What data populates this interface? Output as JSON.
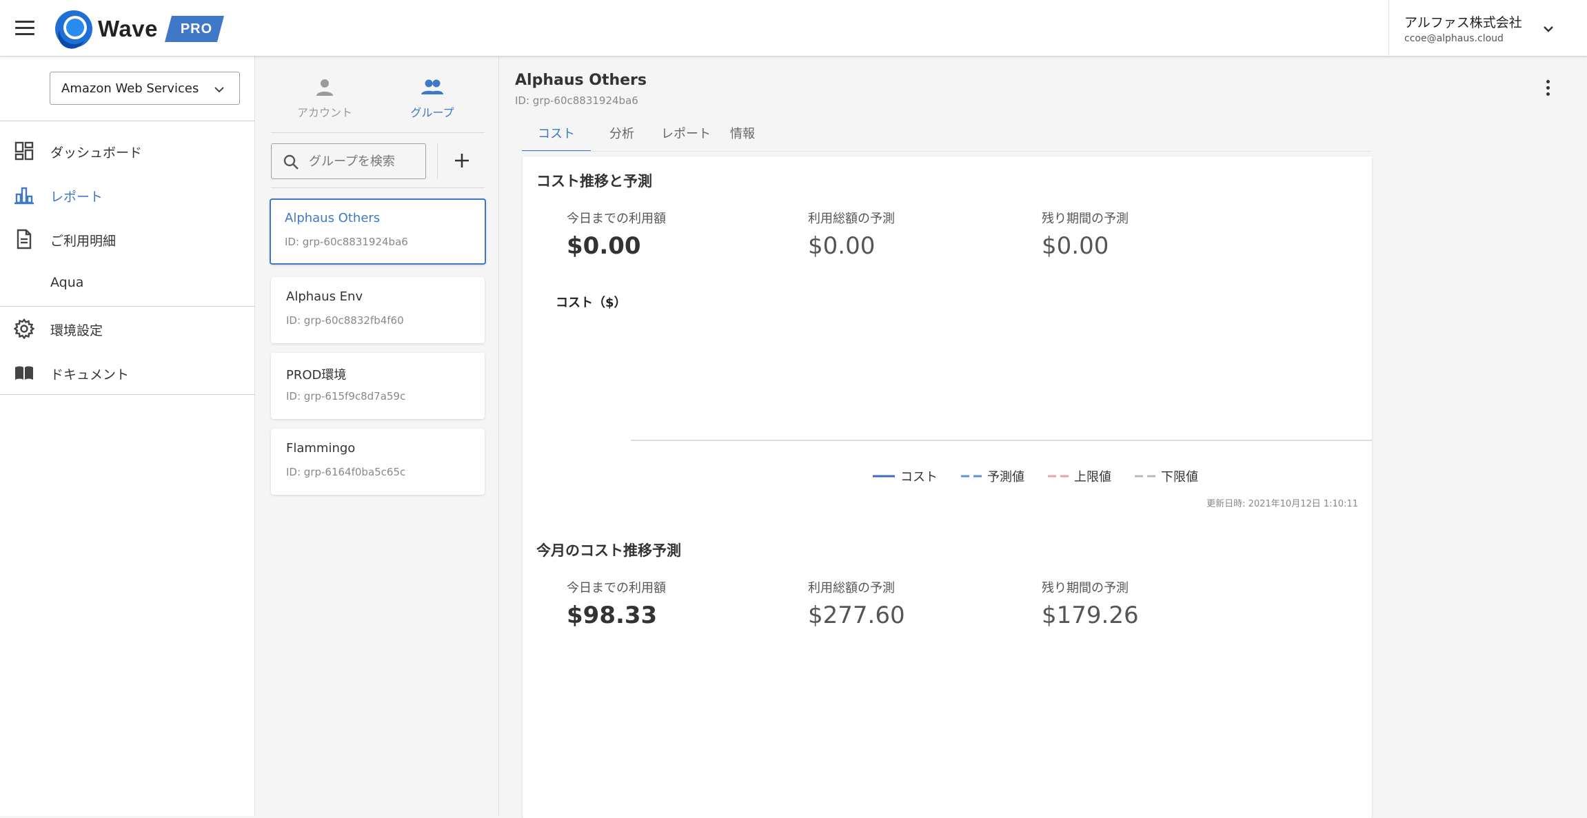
{
  "header": {
    "logo_text": "Wave",
    "logo_badge": "PRO",
    "account_name": "アルファス株式会社",
    "account_email": "ccoe@alphaus.cloud"
  },
  "sidebar": {
    "provider": "Amazon Web Services",
    "items": [
      {
        "label": "ダッシュボード",
        "icon": "dashboard-icon"
      },
      {
        "label": "レポート",
        "icon": "bar-chart-icon",
        "active": true
      },
      {
        "label": "ご利用明細",
        "icon": "document-icon"
      },
      {
        "label": "Aqua",
        "icon": ""
      },
      {
        "label": "環境設定",
        "icon": "gear-icon"
      },
      {
        "label": "ドキュメント",
        "icon": "book-icon"
      }
    ]
  },
  "groups_panel": {
    "tab_account": "アカウント",
    "tab_group": "グループ",
    "search_placeholder": "グループを検索",
    "groups": [
      {
        "name": "Alphaus Others",
        "id": "ID: grp-60c8831924ba6"
      },
      {
        "name": "Alphaus Env",
        "id": "ID: grp-60c8832fb4f60"
      },
      {
        "name": "PROD環境",
        "id": "ID: grp-615f9c8d7a59c"
      },
      {
        "name": "Flammingo",
        "id": "ID: grp-6164f0ba5c65c"
      }
    ]
  },
  "main": {
    "title": "Alphaus Others",
    "id": "ID: grp-60c8831924ba6",
    "tabs": [
      "コスト",
      "分析",
      "レポート",
      "情報"
    ],
    "section1": {
      "title": "コスト推移と予測",
      "stats": [
        {
          "label": "今日までの利用額",
          "value": "$0.00"
        },
        {
          "label": "利用総額の予測",
          "value": "$0.00"
        },
        {
          "label": "残り期間の予測",
          "value": "$0.00"
        }
      ],
      "chart_ylabel": "コスト（$）",
      "legend": [
        {
          "label": "コスト",
          "color": "#3b6cc2",
          "style": "solid"
        },
        {
          "label": "予測値",
          "color": "#5b8fe0",
          "style": "dashed"
        },
        {
          "label": "上限値",
          "color": "#f0a0a0",
          "style": "dashed"
        },
        {
          "label": "下限値",
          "color": "#b8b8b8",
          "style": "dashed"
        }
      ],
      "updated": "更新日時: 2021年10月12日 1:10:11"
    },
    "section2": {
      "title": "今月のコスト推移予測",
      "stats": [
        {
          "label": "今日までの利用額",
          "value": "$98.33"
        },
        {
          "label": "利用総額の予測",
          "value": "$277.60"
        },
        {
          "label": "残り期間の予測",
          "value": "$179.26"
        }
      ]
    }
  },
  "colors": {
    "accent": "#3f78c7",
    "logo_blue": "#1f6fd6"
  }
}
